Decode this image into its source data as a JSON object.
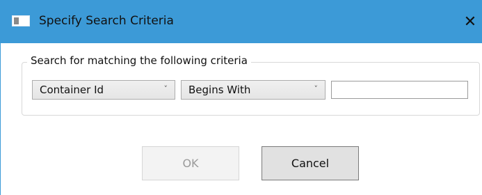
{
  "window": {
    "title": "Specify Search Criteria",
    "close_glyph": "✕",
    "accent_color": "#3c9ad7"
  },
  "criteria_group": {
    "legend": "Search for matching the following criteria",
    "field_select": {
      "selected": "Container Id"
    },
    "operator_select": {
      "selected": "Begins With"
    },
    "value_input": {
      "value": ""
    },
    "chevron_glyph": "˅"
  },
  "buttons": {
    "ok_label": "OK",
    "ok_enabled": false,
    "cancel_label": "Cancel"
  },
  "icons": {
    "app": "window-icon",
    "close": "close-icon",
    "dropdown": "chevron-down-icon"
  }
}
